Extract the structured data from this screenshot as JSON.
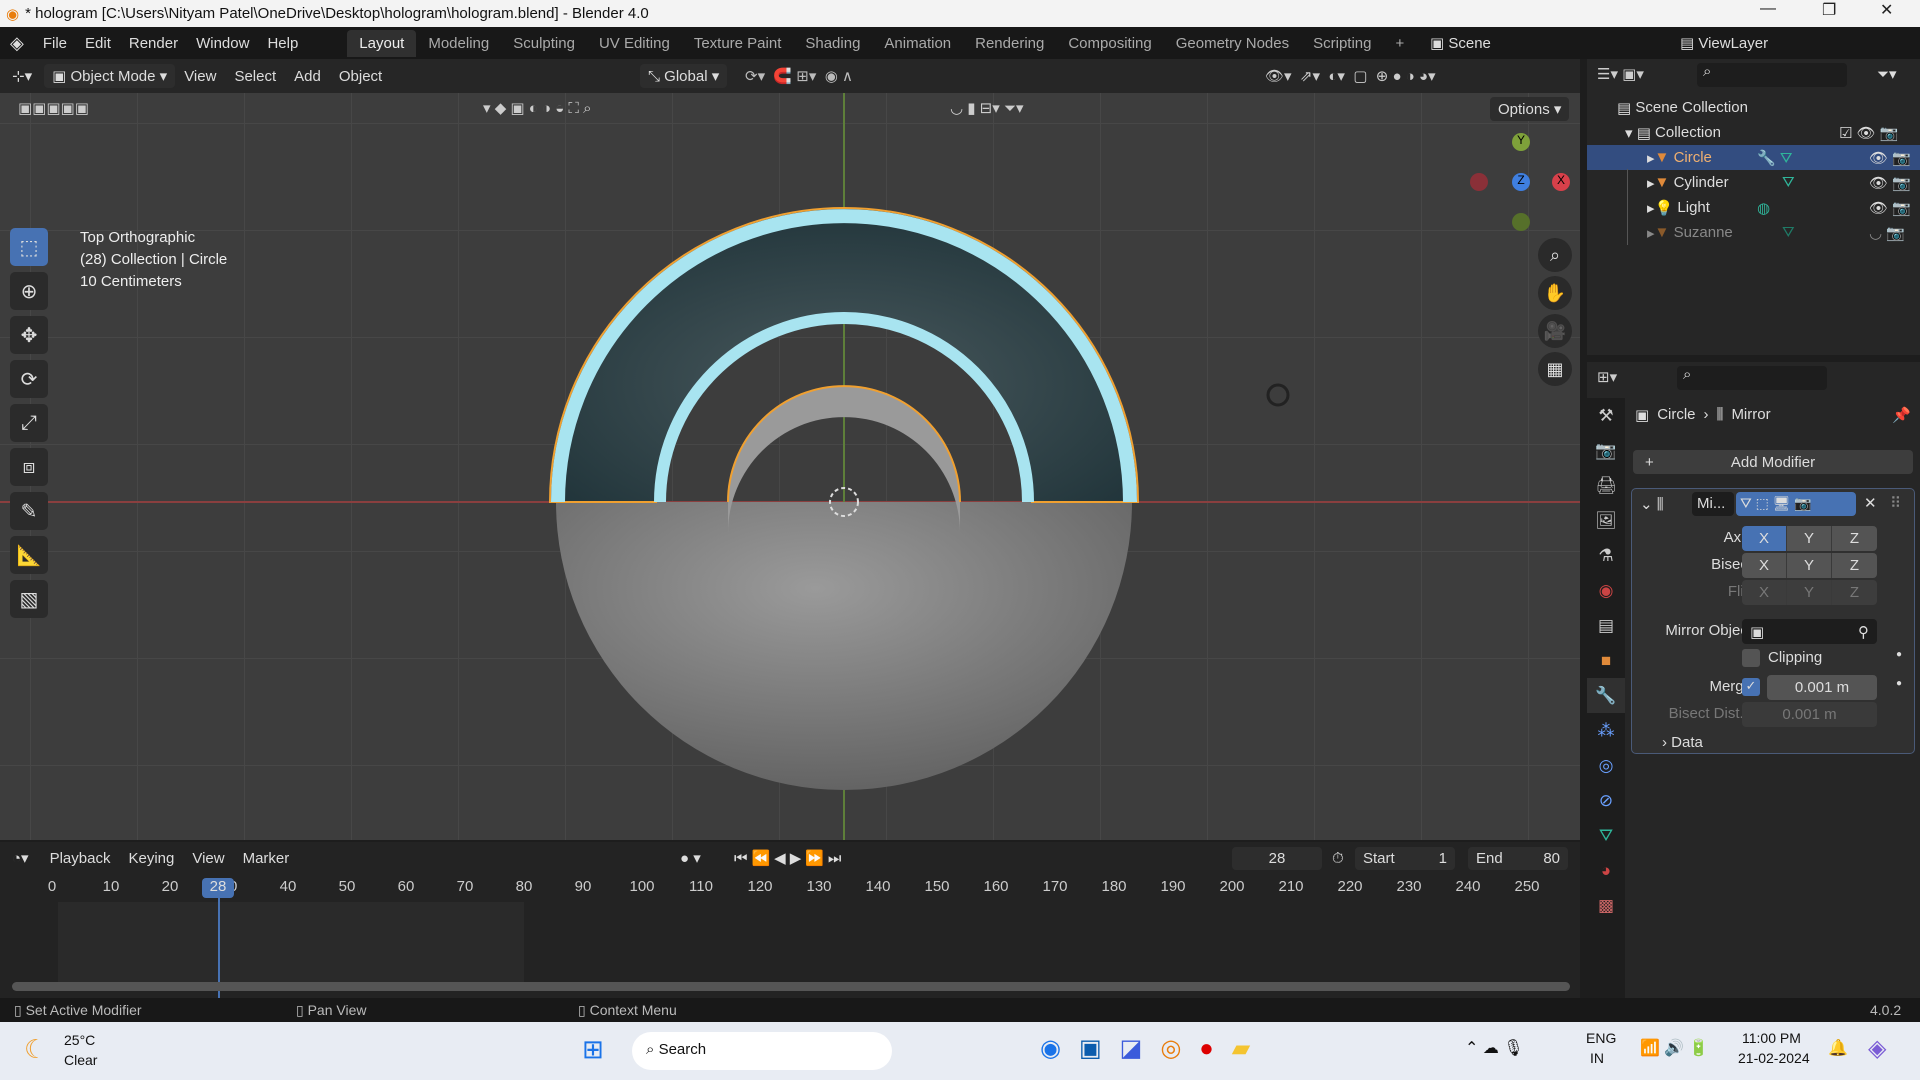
{
  "window": {
    "title": "* hologram [C:\\Users\\Nityam Patel\\OneDrive\\Desktop\\hologram\\hologram.blend] - Blender 4.0",
    "min": "—",
    "max": "❐",
    "close": "✕"
  },
  "menu": [
    "File",
    "Edit",
    "Render",
    "Window",
    "Help"
  ],
  "workspaces": [
    "Layout",
    "Modeling",
    "Sculpting",
    "UV Editing",
    "Texture Paint",
    "Shading",
    "Animation",
    "Rendering",
    "Compositing",
    "Geometry Nodes",
    "Scripting",
    "+"
  ],
  "active_workspace": "Layout",
  "scene": "Scene",
  "view_layer": "ViewLayer",
  "viewport_header": {
    "mode": "Object Mode",
    "menus": [
      "View",
      "Select",
      "Add",
      "Object"
    ],
    "orientation": "Global",
    "options": "Options"
  },
  "viewport_info": {
    "view": "Top Orthographic",
    "collection": "(28) Collection | Circle",
    "scale": "10 Centimeters"
  },
  "gizmo": {
    "x": "X",
    "y": "Y",
    "z": "Z"
  },
  "outliner": {
    "root": "Scene Collection",
    "collection": "Collection",
    "items": [
      {
        "name": "Circle",
        "selected": true,
        "visible": true
      },
      {
        "name": "Cylinder",
        "selected": false,
        "visible": true
      },
      {
        "name": "Light",
        "selected": false,
        "visible": true
      },
      {
        "name": "Suzanne",
        "selected": false,
        "visible": false
      }
    ]
  },
  "properties": {
    "object": "Circle",
    "modifier_crumb": "Mirror",
    "add_modifier": "Add Modifier",
    "modifier": {
      "name": "Mi...",
      "axis_label": "Axis",
      "bisect_label": "Bisect",
      "flip_label": "Flip",
      "axes": [
        "X",
        "Y",
        "Z"
      ],
      "axis_active": "X",
      "mirror_object_label": "Mirror Object",
      "clipping": "Clipping",
      "clipping_checked": false,
      "merge": "Merge",
      "merge_checked": true,
      "merge_value": "0.001 m",
      "bisect_dist": "Bisect Dist...",
      "bisect_value": "0.001 m",
      "data": "Data"
    }
  },
  "timeline": {
    "menus": [
      "Playback",
      "Keying",
      "View",
      "Marker"
    ],
    "current_frame": "28",
    "start_label": "Start",
    "start": "1",
    "end_label": "End",
    "end": "80",
    "ticks": [
      "0",
      "10",
      "20",
      "30",
      "40",
      "50",
      "60",
      "70",
      "80",
      "90",
      "100",
      "110",
      "120",
      "130",
      "140",
      "150",
      "160",
      "170",
      "180",
      "190",
      "200",
      "210",
      "220",
      "230",
      "240",
      "250"
    ]
  },
  "status": {
    "left": "Set Active Modifier",
    "middle": "Pan View",
    "right": "Context Menu",
    "version": "4.0.2"
  },
  "taskbar": {
    "temp": "25°C",
    "weather": "Clear",
    "search": "Search",
    "lang1": "ENG",
    "lang2": "IN",
    "time": "11:00 PM",
    "date": "21-02-2024"
  },
  "colors": {
    "accent": "#4772b3",
    "selection_orange": "#f0a030",
    "hologram": "#a8e4f0"
  }
}
